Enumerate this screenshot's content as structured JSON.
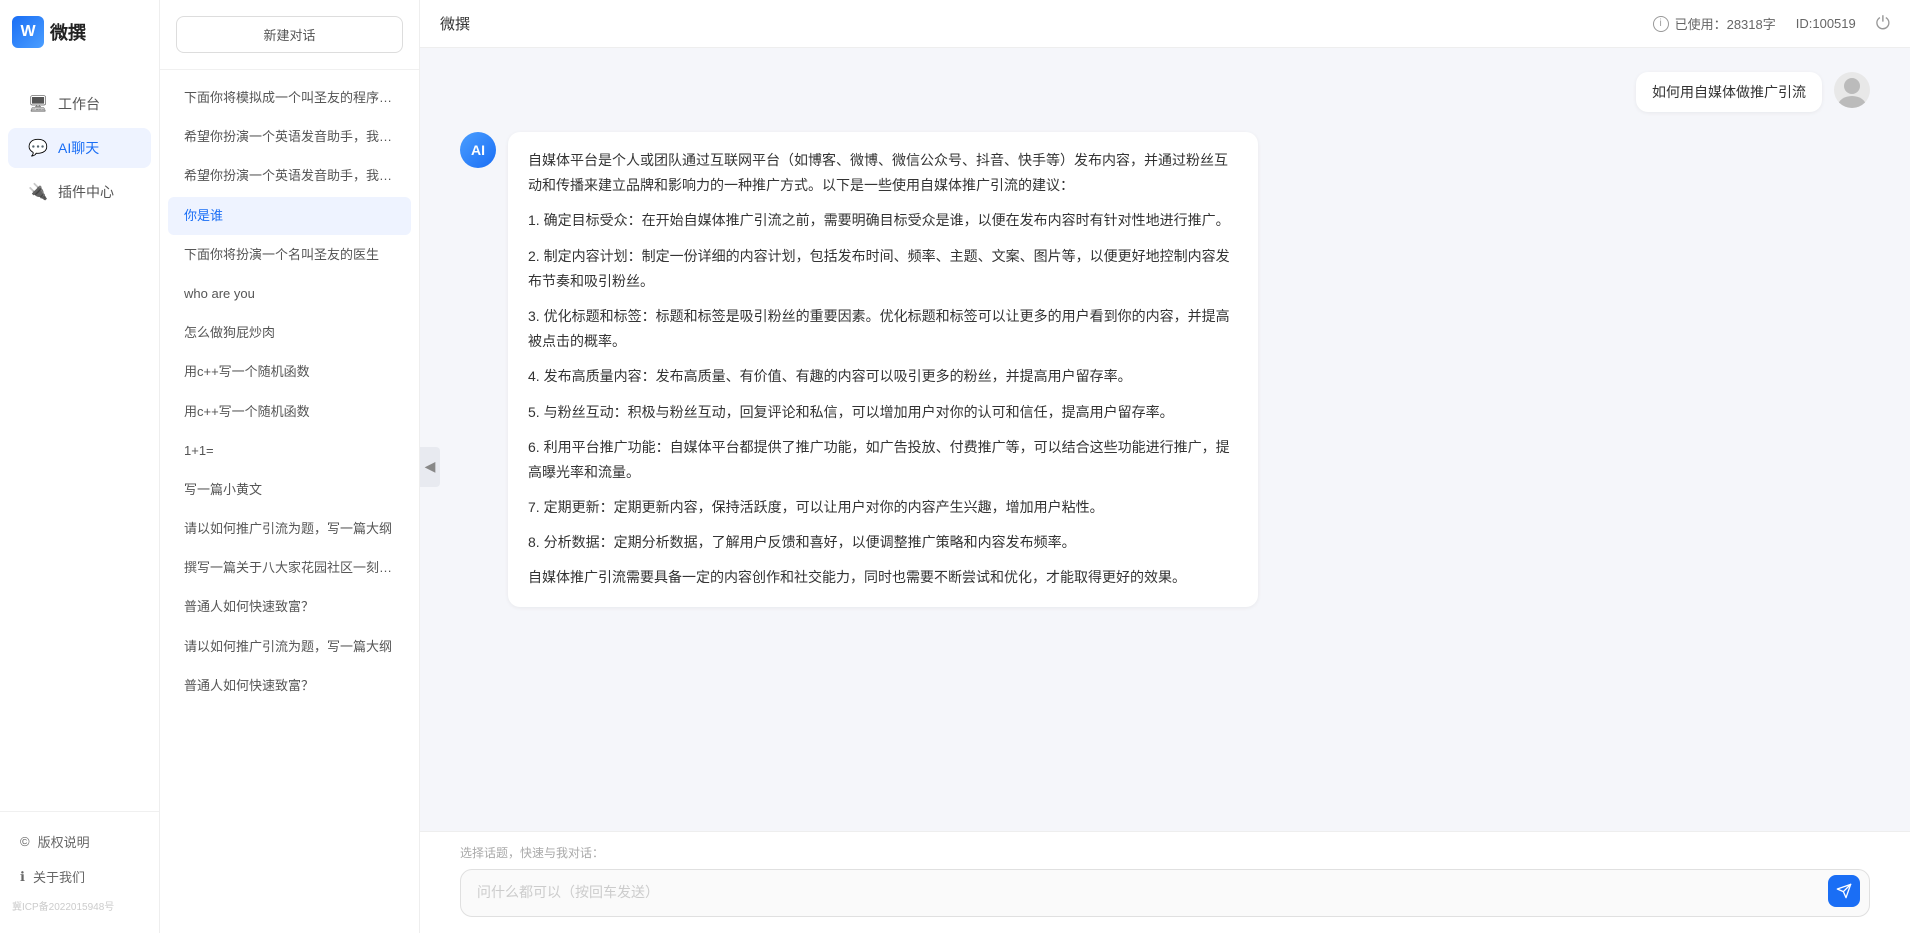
{
  "app": {
    "name": "微撰",
    "logo_letter": "W",
    "page_title": "微撰",
    "usage_label": "已使用：28318字",
    "id_label": "ID:100519"
  },
  "nav": {
    "items": [
      {
        "id": "workbench",
        "label": "工作台",
        "icon": "🖥"
      },
      {
        "id": "ai-chat",
        "label": "AI聊天",
        "icon": "💬",
        "active": true
      },
      {
        "id": "plugin",
        "label": "插件中心",
        "icon": "🔌"
      }
    ],
    "bottom": [
      {
        "id": "copyright",
        "label": "版权说明",
        "icon": "©"
      },
      {
        "id": "about",
        "label": "关于我们",
        "icon": "ℹ"
      }
    ],
    "icp": "冀ICP备2022015948号"
  },
  "history": {
    "new_chat_label": "新建对话",
    "items": [
      {
        "id": 1,
        "text": "下面你将模拟成一个叫圣友的程序员，我说..."
      },
      {
        "id": 2,
        "text": "希望你扮演一个英语发音助手，我提供给你..."
      },
      {
        "id": 3,
        "text": "希望你扮演一个英语发音助手，我提供给你..."
      },
      {
        "id": 4,
        "text": "你是谁",
        "active": true
      },
      {
        "id": 5,
        "text": "下面你将扮演一个名叫圣友的医生"
      },
      {
        "id": 6,
        "text": "who are you"
      },
      {
        "id": 7,
        "text": "怎么做狗屁炒肉"
      },
      {
        "id": 8,
        "text": "用c++写一个随机函数"
      },
      {
        "id": 9,
        "text": "用c++写一个随机函数"
      },
      {
        "id": 10,
        "text": "1+1="
      },
      {
        "id": 11,
        "text": "写一篇小黄文"
      },
      {
        "id": 12,
        "text": "请以如何推广引流为题，写一篇大纲"
      },
      {
        "id": 13,
        "text": "撰写一篇关于八大家花园社区一刻钟便民生..."
      },
      {
        "id": 14,
        "text": "普通人如何快速致富？"
      },
      {
        "id": 15,
        "text": "请以如何推广引流为题，写一篇大纲"
      },
      {
        "id": 16,
        "text": "普通人如何快速致富？"
      }
    ]
  },
  "chat": {
    "user_question": "如何用自媒体做推广引流",
    "ai_response": {
      "paragraphs": [
        "自媒体平台是个人或团队通过互联网平台（如博客、微博、微信公众号、抖音、快手等）发布内容，并通过粉丝互动和传播来建立品牌和影响力的一种推广方式。以下是一些使用自媒体推广引流的建议：",
        "1. 确定目标受众：在开始自媒体推广引流之前，需要明确目标受众是谁，以便在发布内容时有针对性地进行推广。",
        "2. 制定内容计划：制定一份详细的内容计划，包括发布时间、频率、主题、文案、图片等，以便更好地控制内容发布节奏和吸引粉丝。",
        "3. 优化标题和标签：标题和标签是吸引粉丝的重要因素。优化标题和标签可以让更多的用户看到你的内容，并提高被点击的概率。",
        "4. 发布高质量内容：发布高质量、有价值、有趣的内容可以吸引更多的粉丝，并提高用户留存率。",
        "5. 与粉丝互动：积极与粉丝互动，回复评论和私信，可以增加用户对你的认可和信任，提高用户留存率。",
        "6. 利用平台推广功能：自媒体平台都提供了推广功能，如广告投放、付费推广等，可以结合这些功能进行推广，提高曝光率和流量。",
        "7. 定期更新：定期更新内容，保持活跃度，可以让用户对你的内容产生兴趣，增加用户粘性。",
        "8. 分析数据：定期分析数据，了解用户反馈和喜好，以便调整推广策略和内容发布频率。",
        "自媒体推广引流需要具备一定的内容创作和社交能力，同时也需要不断尝试和优化，才能取得更好的效果。"
      ]
    }
  },
  "input": {
    "quick_topics_label": "选择话题，快速与我对话：",
    "placeholder": "问什么都可以（按回车发送）"
  }
}
